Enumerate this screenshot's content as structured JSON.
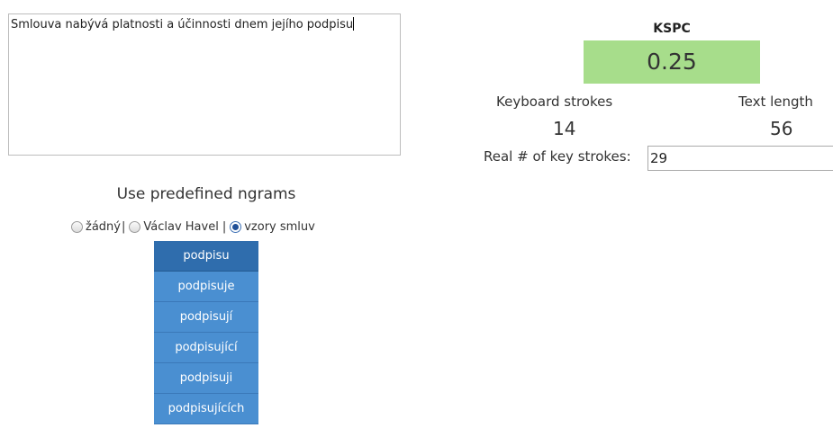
{
  "editor": {
    "text": "Smlouva nabývá platnosti a účinnosti dnem jejího podpisu"
  },
  "ngrams": {
    "title": "Use predefined ngrams",
    "options": [
      {
        "label": "žádný",
        "checked": false
      },
      {
        "label": "Václav Havel",
        "checked": false
      },
      {
        "label": "vzory smluv",
        "checked": true
      }
    ],
    "separator": "|"
  },
  "suggestions": [
    "podpisu",
    "podpisuje",
    "podpisují",
    "podpisující",
    "podpisuji",
    "podpisujících"
  ],
  "stats": {
    "kspc_label": "KSPC",
    "kspc_value": "0.25",
    "kspc_color": "#a7dd8b",
    "keyboard_strokes_label": "Keyboard strokes",
    "keyboard_strokes_value": "14",
    "text_length_label": "Text length",
    "text_length_value": "56",
    "real_label": "Real # of key strokes:",
    "real_value": "29"
  }
}
